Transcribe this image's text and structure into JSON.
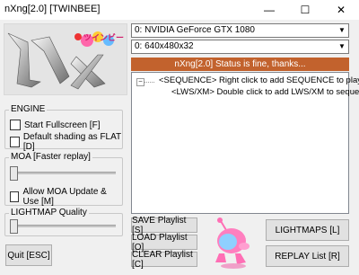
{
  "window": {
    "title": "nXng[2.0] [TWINBEE]",
    "controls": {
      "minimize": "—",
      "maximize": "☐",
      "close": "✕"
    }
  },
  "logo": {
    "text": "nX",
    "badge": "ツインビー"
  },
  "engine": {
    "title": "ENGINE",
    "start_fullscreen": {
      "label": "Start Fullscreen [F]",
      "checked": false
    },
    "default_shading": {
      "label": "Default shading as FLAT [D]",
      "checked": false
    }
  },
  "moa": {
    "title": "MOA [Faster replay]",
    "slider_value": 0,
    "allow_update": {
      "label": "Allow MOA Update & Use [M]",
      "checked": false
    }
  },
  "lightmap": {
    "title": "LIGHTMAP Quality",
    "slider_value": 0
  },
  "buttons": {
    "quit": "Quit [ESC]",
    "save_playlist": "SAVE Playlist [S]",
    "load_playlist": "LOAD Playlist [O]",
    "clear_playlist": "CLEAR Playlist [C]",
    "lightmaps": "LIGHTMAPS [L]",
    "replay_list": "REPLAY List [R]"
  },
  "device_select": {
    "value": "0: NVIDIA GeForce GTX 1080"
  },
  "mode_select": {
    "value": "0: 640x480x32"
  },
  "status": {
    "text": "nXng[2.0] Status is fine, thanks..."
  },
  "tree": {
    "expander": "−",
    "root": "<SEQUENCE> Right click to add SEQUENCE to playlist",
    "child": "<LWS/XM> Double click to add LWS/XM to sequence"
  },
  "colors": {
    "status_bar": "#c2622d"
  }
}
